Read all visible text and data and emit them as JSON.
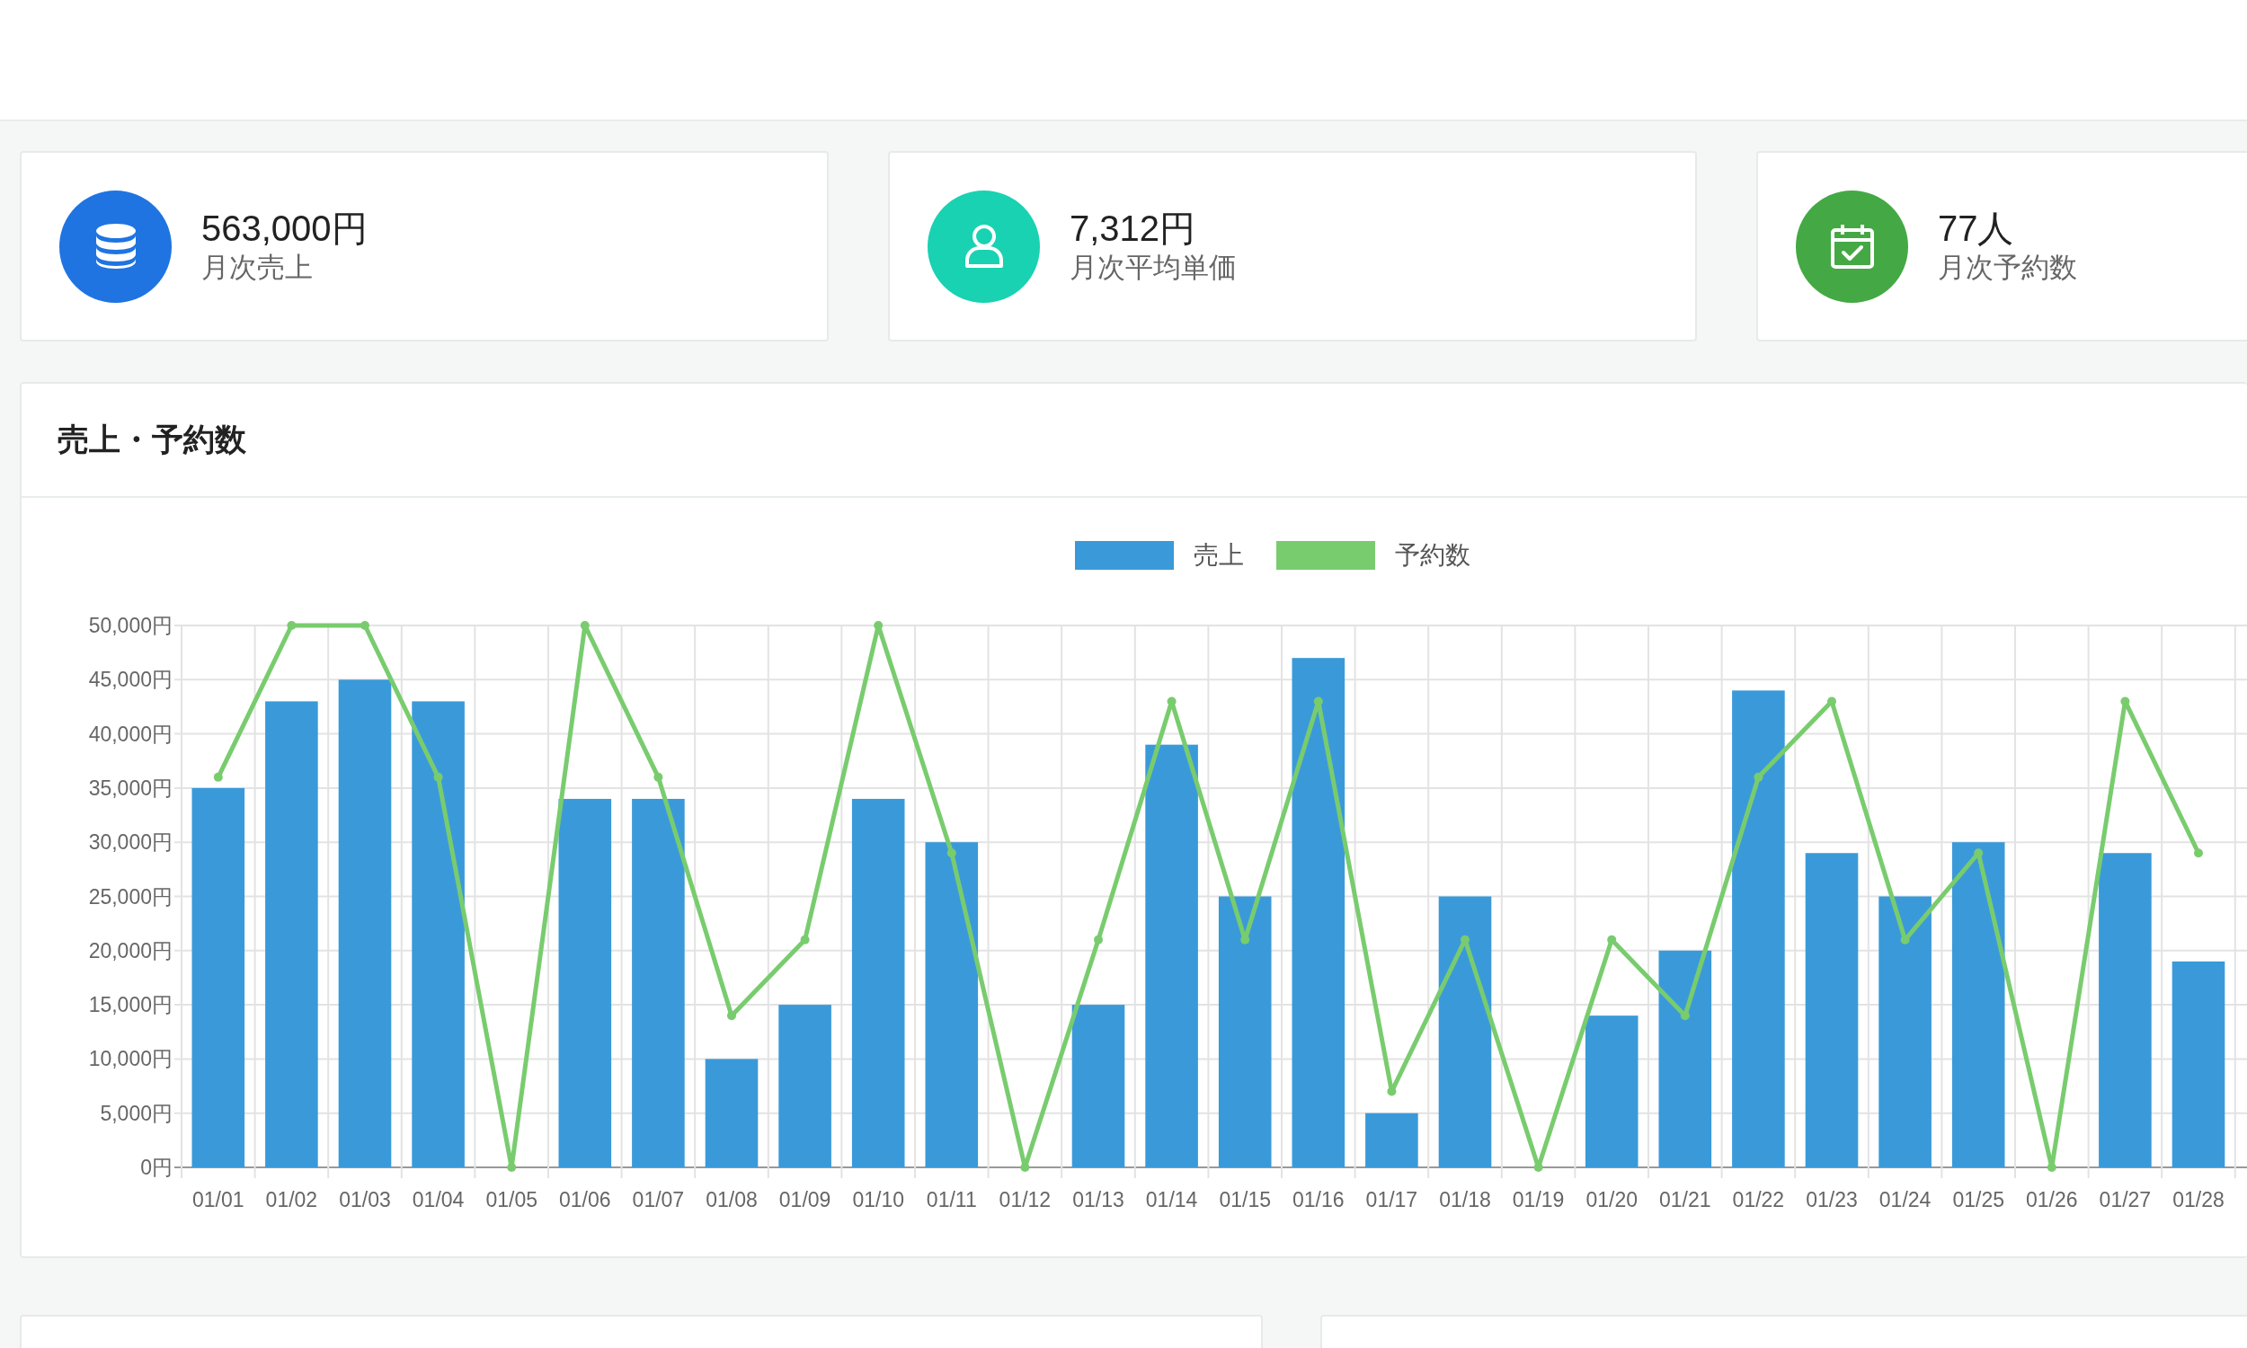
{
  "stats": [
    {
      "value": "563,000円",
      "label": "月次売上",
      "color": "#1f74e2",
      "kind": "database"
    },
    {
      "value": "7,312円",
      "label": "月次平均単価",
      "color": "#18d2b2",
      "kind": "person"
    },
    {
      "value": "77人",
      "label": "月次予約数",
      "color": "#44a944",
      "kind": "calendar"
    }
  ],
  "sales_card": {
    "title": "売上・予約数",
    "chart_data": {
      "type": "bar",
      "categories": [
        "01/01",
        "01/02",
        "01/03",
        "01/04",
        "01/05",
        "01/06",
        "01/07",
        "01/08",
        "01/09",
        "01/10",
        "01/11",
        "01/12",
        "01/13",
        "01/14",
        "01/15",
        "01/16",
        "01/17",
        "01/18",
        "01/19",
        "01/20",
        "01/21",
        "01/22",
        "01/23",
        "01/24",
        "01/25",
        "01/26",
        "01/27",
        "01/28"
      ],
      "series": [
        {
          "name": "売上",
          "color": "#3a9ad9",
          "type": "bar",
          "values": [
            35000,
            43000,
            45000,
            43000,
            0,
            34000,
            34000,
            10000,
            15000,
            34000,
            30000,
            0,
            15000,
            39000,
            25000,
            47000,
            5000,
            25000,
            0,
            14000,
            20000,
            44000,
            29000,
            25000,
            30000,
            0,
            29000,
            19000
          ]
        },
        {
          "name": "予約数",
          "color": "#79cc6e",
          "type": "line",
          "marker": "o",
          "values": [
            36000,
            50000,
            50000,
            36000,
            0,
            50000,
            36000,
            14000,
            21000,
            50000,
            29000,
            0,
            21000,
            43000,
            21000,
            43000,
            7000,
            21000,
            0,
            21000,
            14000,
            36000,
            43000,
            21000,
            29000,
            0,
            43000,
            29000
          ]
        }
      ],
      "ylim": [
        0,
        50000
      ],
      "grid": true,
      "yticks": [
        {
          "value": 0,
          "label": "0円"
        },
        {
          "value": 5000,
          "label": "5,000円"
        },
        {
          "value": 10000,
          "label": "10,000円"
        },
        {
          "value": 15000,
          "label": "15,000円"
        },
        {
          "value": 20000,
          "label": "20,000円"
        },
        {
          "value": 25000,
          "label": "25,000円"
        },
        {
          "value": 30000,
          "label": "30,000円"
        },
        {
          "value": 35000,
          "label": "35,000円"
        },
        {
          "value": 40000,
          "label": "40,000円"
        },
        {
          "value": 45000,
          "label": "45,000円"
        },
        {
          "value": 50000,
          "label": "50,000円"
        }
      ]
    }
  }
}
